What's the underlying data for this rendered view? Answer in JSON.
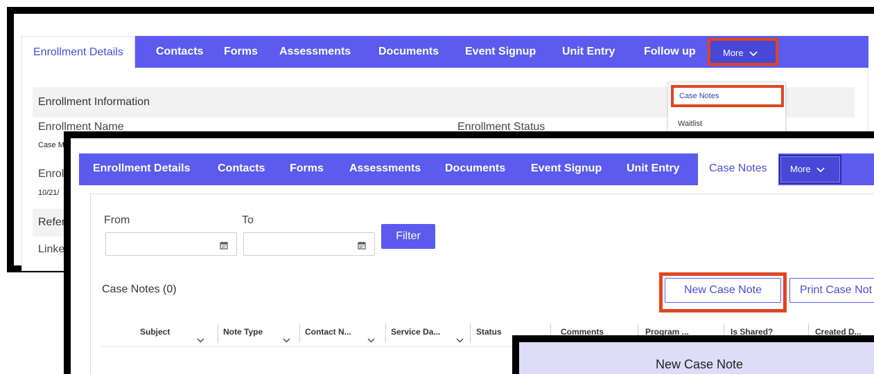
{
  "back_panel": {
    "tabs": [
      "Enrollment Details",
      "Contacts",
      "Forms",
      "Assessments",
      "Documents",
      "Event Signup",
      "Unit Entry",
      "Follow up"
    ],
    "more_label": "More",
    "section_title": "Enrollment Information",
    "enrollment_name_label": "Enrollment Name",
    "enrollment_status_label": "Enrollment Status",
    "enrollment_name_value": "Case M",
    "enrollment_date_label": "Enrol",
    "enrollment_date_value": "10/21/",
    "referral_label": "Refer",
    "linked_label": "Linke",
    "dropdown": {
      "items": [
        "Case Notes",
        "Waitlist"
      ]
    }
  },
  "front_panel": {
    "tabs": [
      "Enrollment Details",
      "Contacts",
      "Forms",
      "Assessments",
      "Documents",
      "Event Signup",
      "Unit Entry",
      "Case Notes"
    ],
    "more_label": "More",
    "filter": {
      "from_label": "From",
      "to_label": "To",
      "filter_button": "Filter"
    },
    "case_notes_title": "Case Notes (0)",
    "new_case_note_button": "New Case Note",
    "print_case_notes_button": "Print Case Not",
    "columns": [
      "Subject",
      "Note Type",
      "Contact N...",
      "Service Da...",
      "Status",
      "Comments",
      "Program ...",
      "Is Shared?",
      "Created D..."
    ]
  },
  "modal": {
    "title": "New Case Note"
  },
  "colors": {
    "tab_bar": "#5b5bef",
    "highlight": "#e0451f",
    "modal_header": "#dedcf8"
  },
  "icons": {
    "calendar": "calendar-icon",
    "chevron": "chevron-down-icon"
  }
}
